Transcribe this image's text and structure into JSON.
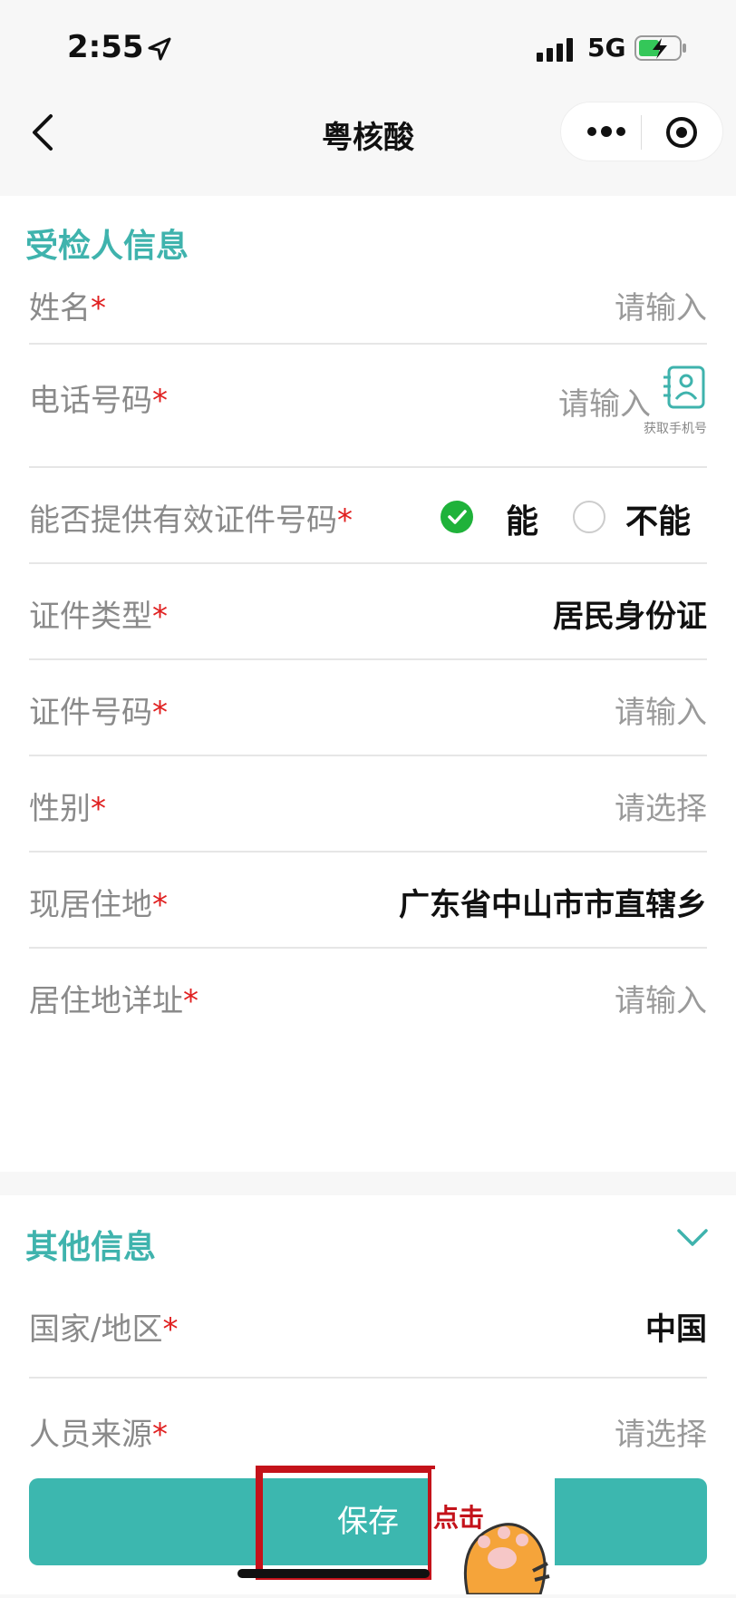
{
  "status": {
    "time": "2:55",
    "network": "5G"
  },
  "nav": {
    "title": "粤核酸"
  },
  "colors": {
    "accent": "#3fb3ad",
    "required": "#e02020",
    "check": "#1fb23a",
    "highlight": "#c4121a"
  },
  "section1": {
    "title": "受检人信息",
    "fields": {
      "name": {
        "label": "姓名",
        "value": "请输入"
      },
      "phone": {
        "label": "电话号码",
        "value": "请输入",
        "hint": "获取手机号"
      },
      "has_id": {
        "label": "能否提供有效证件号码",
        "option_yes": "能",
        "option_no": "不能",
        "selected": "能"
      },
      "id_type": {
        "label": "证件类型",
        "value": "居民身份证"
      },
      "id_number": {
        "label": "证件号码",
        "value": "请输入"
      },
      "gender": {
        "label": "性别",
        "value": "请选择"
      },
      "residence": {
        "label": "现居住地",
        "value": "广东省中山市市直辖乡"
      },
      "address": {
        "label": "居住地详址",
        "value": "请输入"
      }
    }
  },
  "section2": {
    "title": "其他信息",
    "fields": {
      "country": {
        "label": "国家/地区",
        "value": "中国"
      },
      "source": {
        "label": "人员来源",
        "value": "请选择"
      }
    }
  },
  "required_mark": "*",
  "save": {
    "label": "保存"
  },
  "sticker": {
    "text": "点击"
  },
  "icons": [
    "location-arrow-icon",
    "signal-icon",
    "battery-icon",
    "back-icon",
    "more-icon",
    "target-icon",
    "contact-card-icon",
    "check-icon",
    "chevron-down-icon",
    "paw-icon"
  ]
}
